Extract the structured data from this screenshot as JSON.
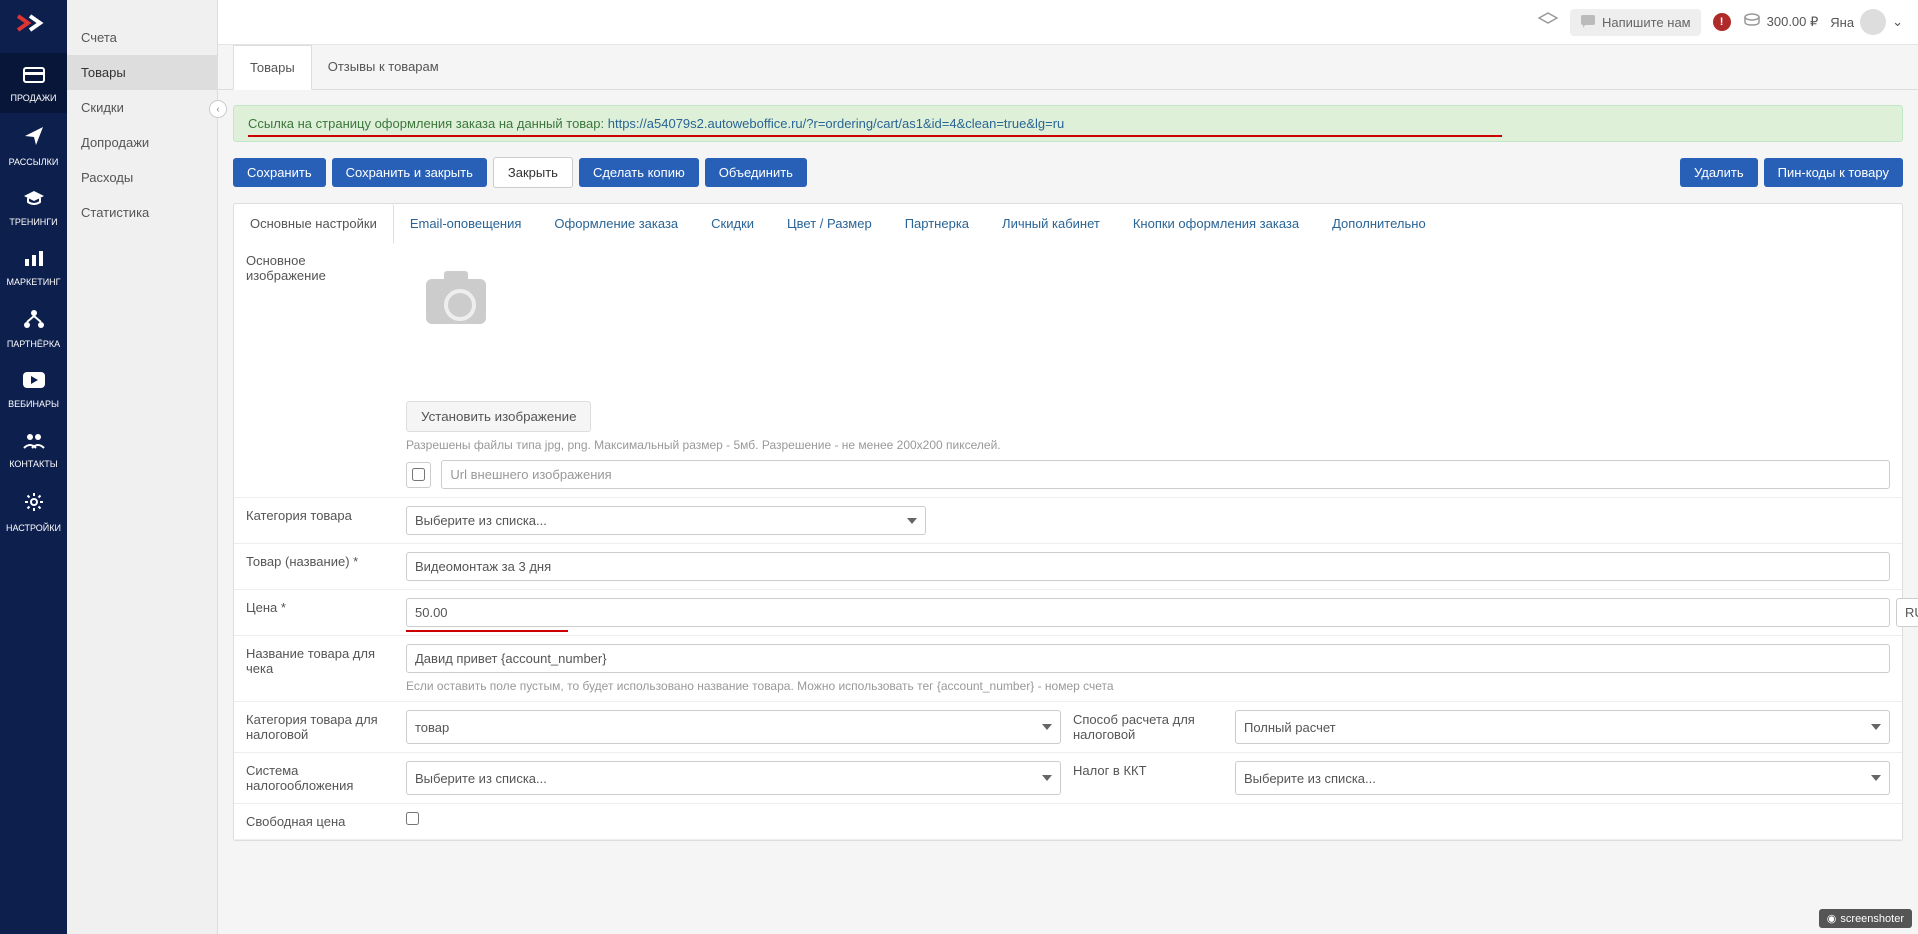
{
  "nav_dark": [
    {
      "label": "ПРОДАЖИ",
      "icon": "card"
    },
    {
      "label": "РАССЫЛКИ",
      "icon": "send"
    },
    {
      "label": "ТРЕНИНГИ",
      "icon": "grad"
    },
    {
      "label": "МАРКЕТИНГ",
      "icon": "chart"
    },
    {
      "label": "ПАРТНЁРКА",
      "icon": "nodes"
    },
    {
      "label": "ВЕБИНАРЫ",
      "icon": "play"
    },
    {
      "label": "КОНТАКТЫ",
      "icon": "users"
    },
    {
      "label": "НАСТРОЙКИ",
      "icon": "gear"
    }
  ],
  "nav_light": [
    "Счета",
    "Товары",
    "Скидки",
    "Допродажи",
    "Расходы",
    "Статистика"
  ],
  "header": {
    "write_us": "Напишите нам",
    "balance": "300.00 ₽",
    "user": "Яна"
  },
  "subtabs": [
    "Товары",
    "Отзывы к товарам"
  ],
  "alert": {
    "prefix": "Ссылка на страницу оформления заказа на данный товар: ",
    "link": "https://a54079s2.autoweboffice.ru/?r=ordering/cart/as1&id=4&clean=true&lg=ru"
  },
  "buttons": {
    "save": "Сохранить",
    "save_close": "Сохранить и закрыть",
    "close": "Закрыть",
    "copy": "Сделать копию",
    "merge": "Объединить",
    "delete": "Удалить",
    "pins": "Пин-коды к товару"
  },
  "form_tabs": [
    "Основные настройки",
    "Email-оповещения",
    "Оформление заказа",
    "Скидки",
    "Цвет / Размер",
    "Партнерка",
    "Личный кабинет",
    "Кнопки оформления заказа",
    "Дополнительно"
  ],
  "form": {
    "image_label": "Основное изображение",
    "set_image": "Установить изображение",
    "image_help": "Разрешены файлы типа jpg, png. Максимальный размер - 5мб. Разрешение - не менее 200х200 пикселей.",
    "url_placeholder": "Url внешнего изображения",
    "category_label": "Категория товара",
    "category_placeholder": "Выберите из списка...",
    "name_label": "Товар (название) *",
    "name_value": "Видеомонтаж за 3 дня",
    "price_label": "Цена *",
    "price_value": "50.00",
    "currency": "RUB",
    "receipt_name_label": "Название товара для чека",
    "receipt_name_value": "Давид привет {account_number}",
    "receipt_help": "Если оставить поле пустым, то будет использовано название товара. Можно использовать тег {account_number} - номер счета",
    "tax_category_label": "Категория товара для налоговой",
    "tax_category_value": "товар",
    "payment_method_label": "Способ расчета для налоговой",
    "payment_method_value": "Полный расчет",
    "tax_system_label": "Система налогообложения",
    "tax_system_placeholder": "Выберите из списка...",
    "kkt_label": "Налог в ККТ",
    "kkt_placeholder": "Выберите из списка...",
    "free_price_label": "Свободная цена"
  },
  "screenshoter": "screenshoter"
}
